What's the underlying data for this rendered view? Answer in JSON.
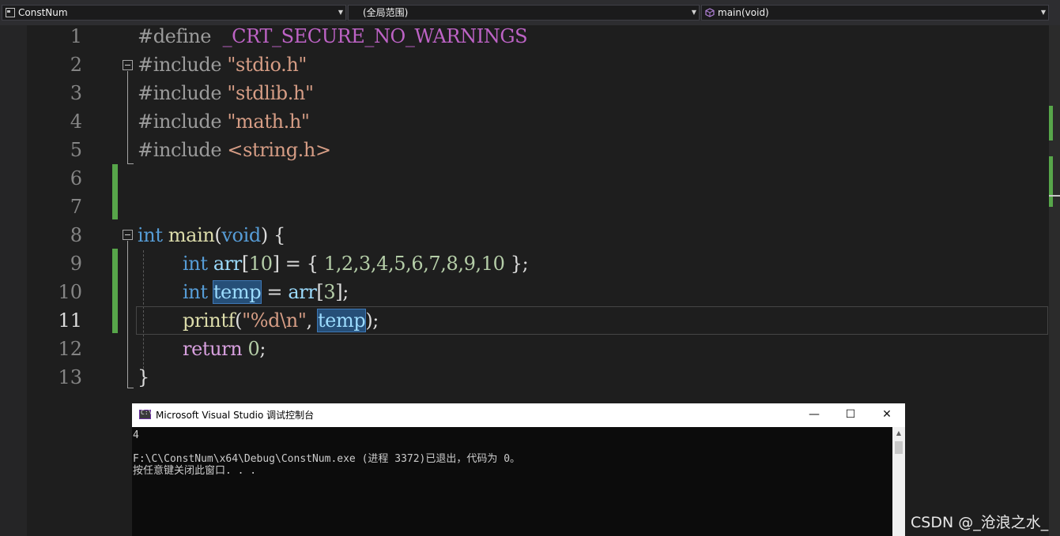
{
  "navbar": {
    "project": "ConstNum",
    "scope": "(全局范围)",
    "member": "main(void)",
    "dropdown_glyph": "▼"
  },
  "editor": {
    "current_line": 11,
    "lines": [
      {
        "n": "1"
      },
      {
        "n": "2"
      },
      {
        "n": "3"
      },
      {
        "n": "4"
      },
      {
        "n": "5"
      },
      {
        "n": "6"
      },
      {
        "n": "7"
      },
      {
        "n": "8"
      },
      {
        "n": "9"
      },
      {
        "n": "10"
      },
      {
        "n": "11"
      },
      {
        "n": "12"
      },
      {
        "n": "13"
      }
    ],
    "code": {
      "l1": {
        "directive": "#define",
        "macro": "_CRT_SECURE_NO_WARNINGS"
      },
      "l2": {
        "directive": "#include",
        "header": "\"stdio.h\""
      },
      "l3": {
        "directive": "#include",
        "header": "\"stdlib.h\""
      },
      "l4": {
        "directive": "#include",
        "header": "\"math.h\""
      },
      "l5": {
        "directive": "#include",
        "header": "<string.h>"
      },
      "l8": {
        "type": "int",
        "fname": "main",
        "open": "(",
        "param": "void",
        "close": ") {"
      },
      "l9": {
        "type": "int",
        "var": "arr",
        "lb": "[",
        "size": "10",
        "rest": "] = { ",
        "values": "1,2,3,4,5,6,7,8,9,10",
        "end": " };"
      },
      "l10": {
        "type": "int",
        "var": "temp",
        "eq": " = ",
        "arr": "arr",
        "lb": "[",
        "idx": "3",
        "end": "];"
      },
      "l11": {
        "fname": "printf",
        "open": "(",
        "fmt": "\"%d\\n\"",
        "comma": ", ",
        "var": "temp",
        "end": ");"
      },
      "l12": {
        "kw": "return",
        "value": "0",
        "end": ";"
      },
      "l13": {
        "text": "}"
      }
    }
  },
  "console": {
    "title": "Microsoft Visual Studio 调试控制台",
    "icon_text": "C:\\",
    "minimize": "—",
    "maximize": "☐",
    "close": "✕",
    "output": [
      "4",
      "",
      "F:\\C\\ConstNum\\x64\\Debug\\ConstNum.exe (进程 3372)已退出，代码为 0。",
      "按任意键关闭此窗口. . ."
    ],
    "scroll_up": "▲"
  },
  "watermark": "CSDN @_沧浪之水_",
  "colors": {
    "keyword": "#569cd6",
    "string": "#d69d85",
    "macro": "#bd63c5",
    "function": "#dcdcaa",
    "variable": "#9cdcfe",
    "number": "#b5cea8",
    "change_bar": "#57a64a"
  }
}
